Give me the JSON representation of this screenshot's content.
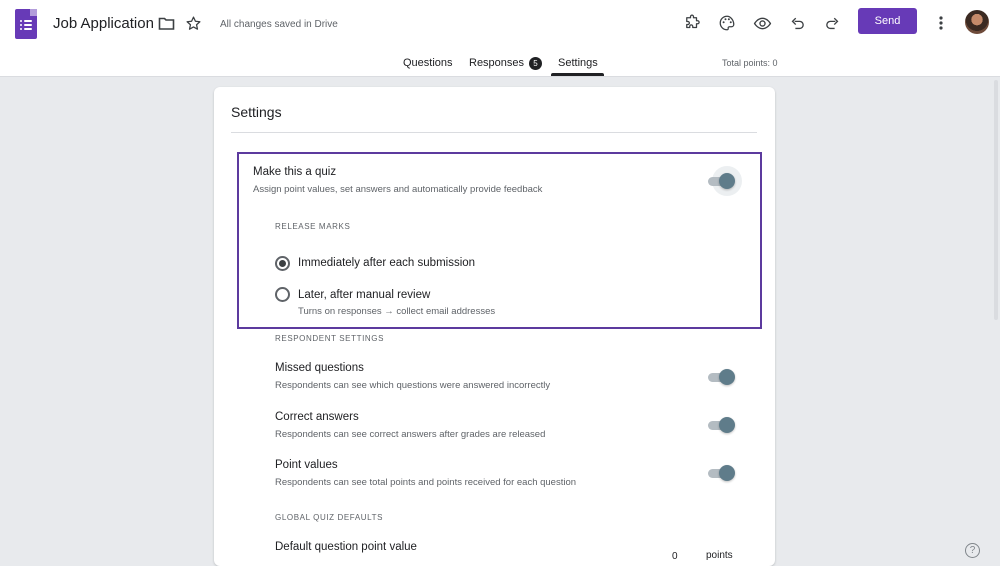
{
  "header": {
    "title": "Job Application",
    "save_status": "All changes saved in Drive",
    "send_label": "Send",
    "icons": [
      "forms-logo-icon",
      "folder-icon",
      "star-icon",
      "addon-puzzle-icon",
      "palette-icon",
      "preview-eye-icon",
      "undo-icon",
      "redo-icon",
      "more-vert-icon"
    ],
    "accent_color": "#673ab7"
  },
  "tabs": {
    "items": [
      {
        "label": "Questions"
      },
      {
        "label": "Responses",
        "badge": "5"
      },
      {
        "label": "Settings",
        "active": true
      }
    ],
    "total_points": "Total points: 0"
  },
  "settings": {
    "title": "Settings",
    "quiz": {
      "title": "Make this a quiz",
      "description": "Assign point values, set answers and automatically provide feedback",
      "enabled": true
    },
    "release_marks": {
      "label": "RELEASE MARKS",
      "options": [
        {
          "label": "Immediately after each submission",
          "selected": true
        },
        {
          "label": "Later, after manual review",
          "note": "Turns on responses → collect email addresses",
          "selected": false
        }
      ]
    },
    "respondent": {
      "label": "RESPONDENT SETTINGS",
      "items": [
        {
          "title": "Missed questions",
          "description": "Respondents can see which questions were answered incorrectly",
          "enabled": true
        },
        {
          "title": "Correct answers",
          "description": "Respondents can see correct answers after grades are released",
          "enabled": true
        },
        {
          "title": "Point values",
          "description": "Respondents can see total points and points received for each question",
          "enabled": true
        }
      ]
    },
    "global": {
      "label": "GLOBAL QUIZ DEFAULTS",
      "default_point_title": "Default question point value",
      "default_point_value": "0",
      "points_unit": "points"
    }
  },
  "help_label": "?"
}
